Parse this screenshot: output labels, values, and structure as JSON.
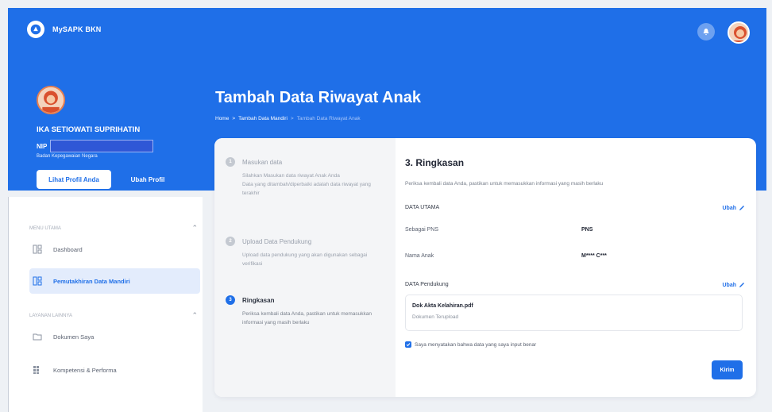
{
  "app": {
    "brand": "MySAPK BKN"
  },
  "profile": {
    "name": "IKA SETIOWATI SUPRIHATIN",
    "nip_label": "NIP",
    "org": "Badan Kepegawaian Negara",
    "lihat_label": "Lihat Profil Anda",
    "ubah_label": "Ubah Profil"
  },
  "page": {
    "title": "Tambah Data Riwayat Anak",
    "breadcrumb": [
      "Home",
      ">",
      "Tambah Data Mandiri",
      ">",
      "Tambah Data Riwayat Anak"
    ]
  },
  "sidebar": {
    "sections": [
      {
        "title": "MENU UTAMA",
        "items": [
          {
            "label": "Dashboard",
            "icon": "dashboard-icon"
          },
          {
            "label": "Pemutakhiran Data Mandiri",
            "icon": "update-icon",
            "active": true
          }
        ]
      },
      {
        "title": "LAYANAN LAINNYA",
        "items": [
          {
            "label": "Dokumen Saya",
            "icon": "folder-icon"
          },
          {
            "label": "Kompetensi & Performa",
            "icon": "grid-icon"
          }
        ]
      }
    ]
  },
  "steps": [
    {
      "number": "1",
      "title": "Masukan data",
      "desc": "Silahkan Masukan data riwayat Anak Anda\nData yang ditambah/diperbaiki adalah data riwayat yang terakhir"
    },
    {
      "number": "2",
      "title": "Upload Data Pendukung",
      "desc": "Upload data pendukung yang akan digunakan sebagai verifikasi"
    },
    {
      "number": "3",
      "title": "Ringkasan",
      "desc": "Periksa kembali data Anda, pastikan untuk memasukkan informasi yang masih berlaku",
      "active": true
    }
  ],
  "summary": {
    "title": "3. Ringkasan",
    "subtitle": "Periksa kembali data Anda, pastikan untuk memasukkan informasi yang masih berlaku",
    "data_utama_label": "DATA UTAMA",
    "ubah_label": "Ubah",
    "rows": [
      {
        "label": "Sebagai PNS",
        "value": "PNS"
      },
      {
        "label": "Nama Anak",
        "value": "M**** C***"
      }
    ],
    "pendukung_label": "DATA Pendukung",
    "doc_name": "Dok Akta Kelahiran.pdf",
    "doc_status": "Dokumen Terupload",
    "confirm_text": "Saya menyatakan bahwa data yang saya input benar",
    "confirm_checked": true,
    "submit_label": "Kirim"
  },
  "colors": {
    "primary": "#1f6fe8",
    "active_bg": "#e3ecfc"
  }
}
